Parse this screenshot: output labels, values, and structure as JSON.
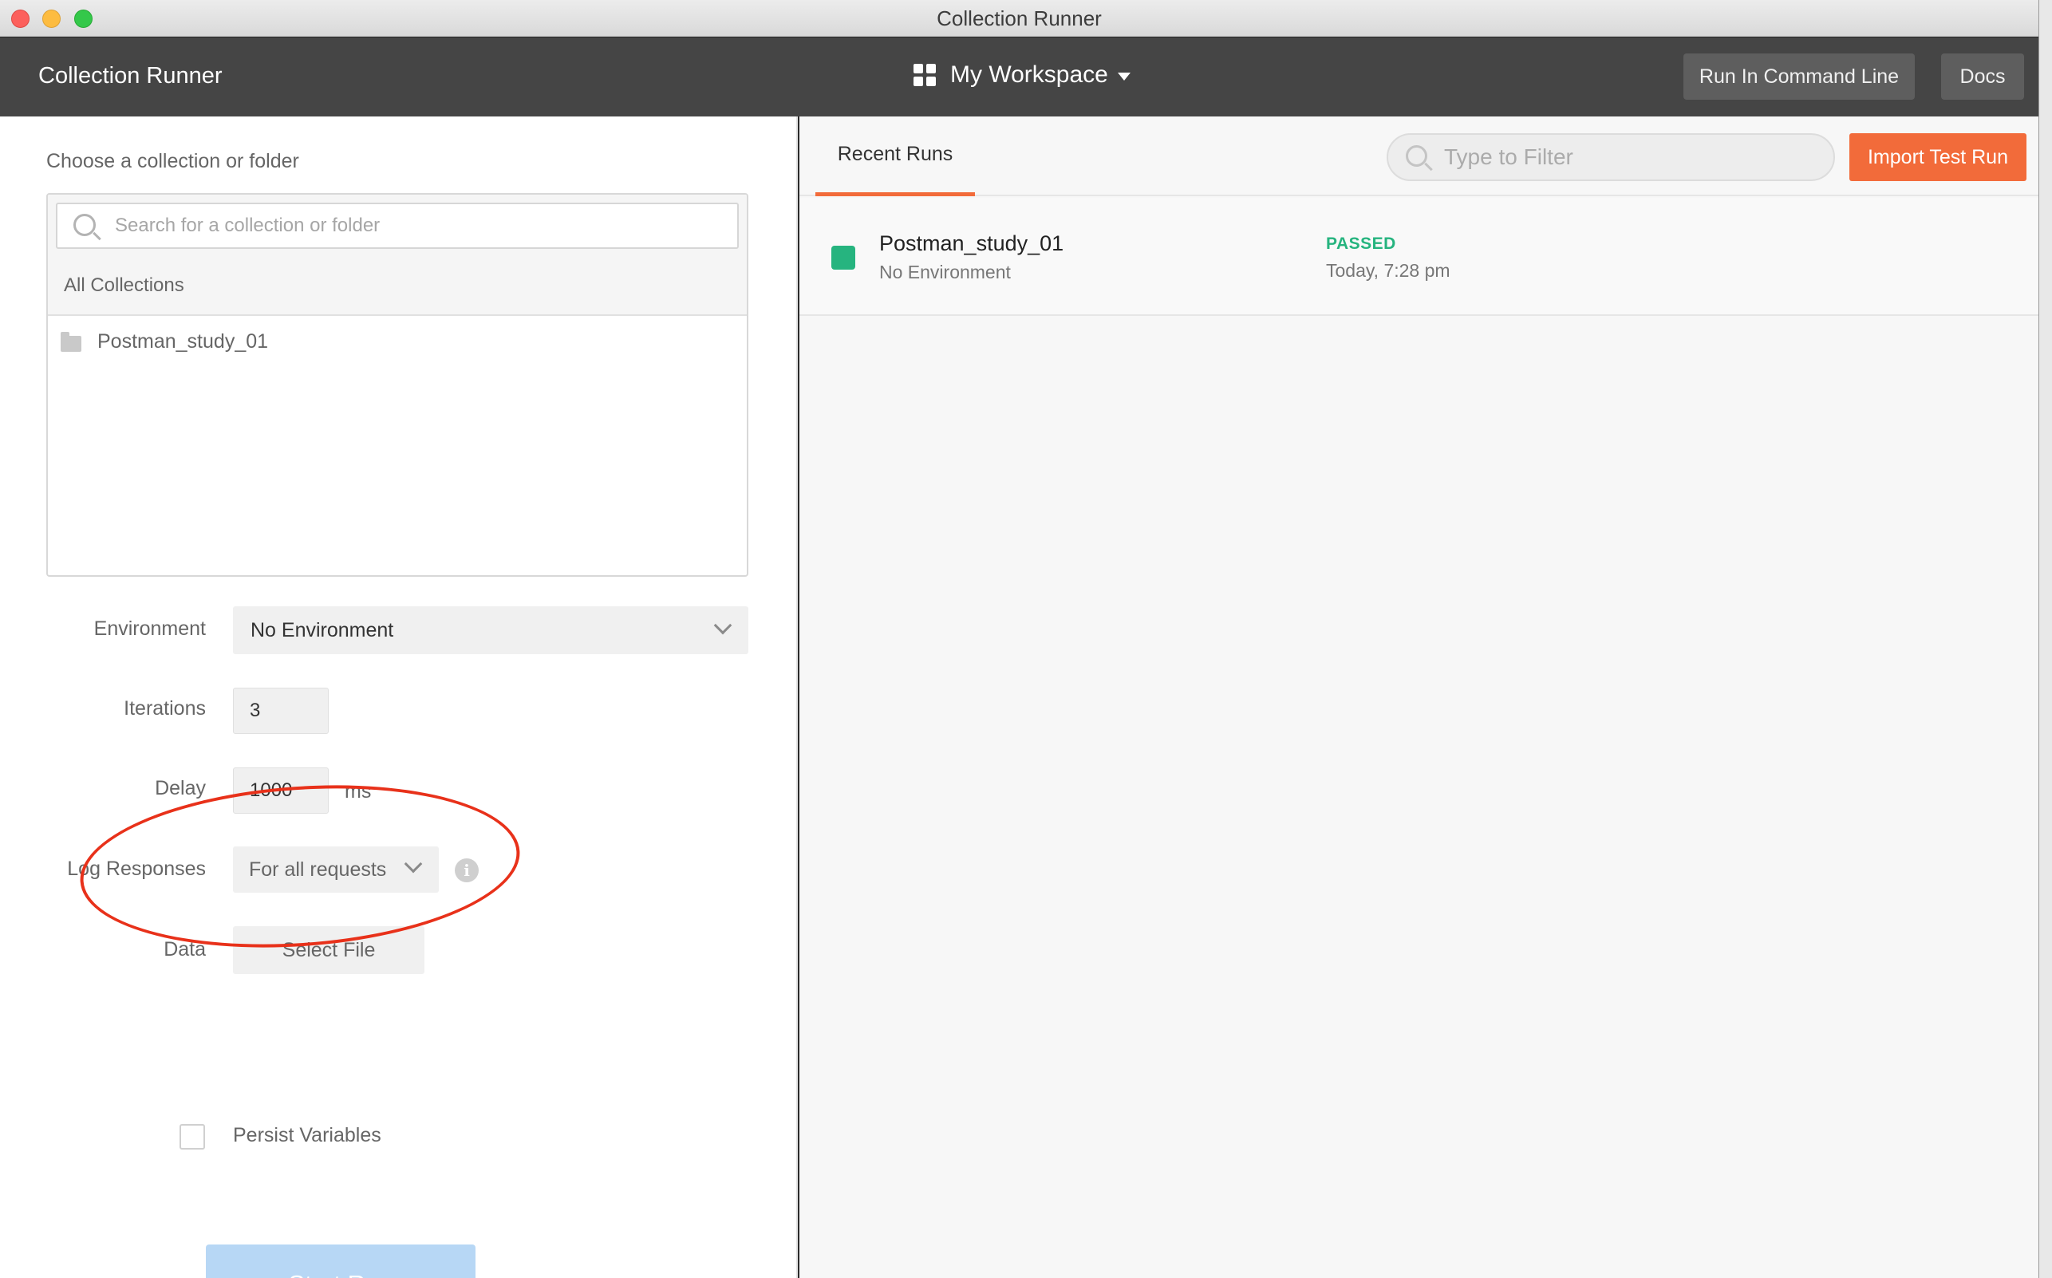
{
  "window": {
    "title": "Collection Runner"
  },
  "header": {
    "app_title": "Collection Runner",
    "workspace_label": "My Workspace",
    "run_cli_label": "Run In Command Line",
    "docs_label": "Docs"
  },
  "left": {
    "choose_label": "Choose a collection or folder",
    "search_placeholder": "Search for a collection or folder",
    "all_collections_label": "All Collections",
    "collections": [
      {
        "name": "Postman_study_01"
      }
    ],
    "environment_label": "Environment",
    "environment_value": "No Environment",
    "iterations_label": "Iterations",
    "iterations_value": "3",
    "delay_label": "Delay",
    "delay_value": "1000",
    "delay_unit": "ms",
    "log_label": "Log Responses",
    "log_value": "For all requests",
    "data_label": "Data",
    "select_file_label": "Select File",
    "persist_label": "Persist Variables",
    "persist_checked": false,
    "start_label": "Start Run"
  },
  "right": {
    "tab_label": "Recent Runs",
    "filter_placeholder": "Type to Filter",
    "import_label": "Import Test Run",
    "runs": [
      {
        "name": "Postman_study_01",
        "environment": "No Environment",
        "status": "PASSED",
        "time": "Today, 7:28 pm"
      }
    ]
  },
  "colors": {
    "accent": "#f26b3a",
    "passed": "#26b47f",
    "start_button": "#b7d7f5",
    "header_bg": "#454545",
    "annotation": "#e8311a"
  }
}
